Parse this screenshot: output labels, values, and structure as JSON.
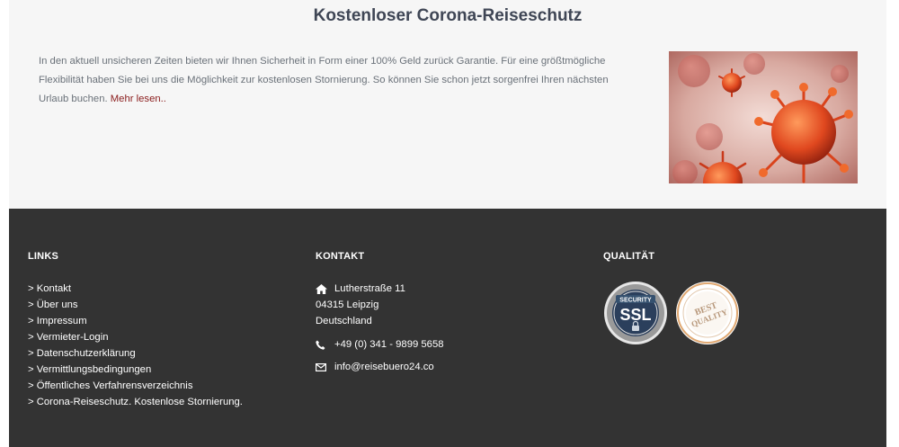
{
  "section": {
    "title": "Kostenloser Corona-Reiseschutz",
    "text": "In den aktuell unsicheren Zeiten bieten wir Ihnen Sicherheit in Form einer 100% Geld zurück Garantie. Für eine größtmögliche Flexibilität haben Sie bei uns die Möglichkeit zur kostenlosen Stornierung. So können Sie schon jetzt sorgenfrei Ihren nächsten Urlaub buchen. ",
    "more_link": "Mehr lesen..",
    "accent_color": "#8a1c1c"
  },
  "footer": {
    "links": {
      "heading": "LINKS",
      "items": [
        "> Kontakt",
        "> Über uns",
        "> Impressum",
        "> Vermieter-Login",
        "> Datenschutzerklärung",
        "> Vermittlungsbedingungen",
        "> Öffentliches Verfahrensverzeichnis",
        "> Corona-Reiseschutz. Kostenlose Stornierung."
      ]
    },
    "contact": {
      "heading": "KONTAKT",
      "street": "Lutherstraße 11",
      "city": "04315 Leipzig",
      "country": "Deutschland",
      "phone": "+49 (0) 341 - 9899 5658",
      "email": "info@reisebuero24.co",
      "icons": [
        "home-icon",
        "phone-icon",
        "envelope-icon"
      ]
    },
    "quality": {
      "heading": "QUALITÄT",
      "ssl_badge_text": "SSL",
      "ssl_badge_small": "SECURITY",
      "best_badge_line1": "BEST",
      "best_badge_line2": "QUALITY"
    }
  }
}
